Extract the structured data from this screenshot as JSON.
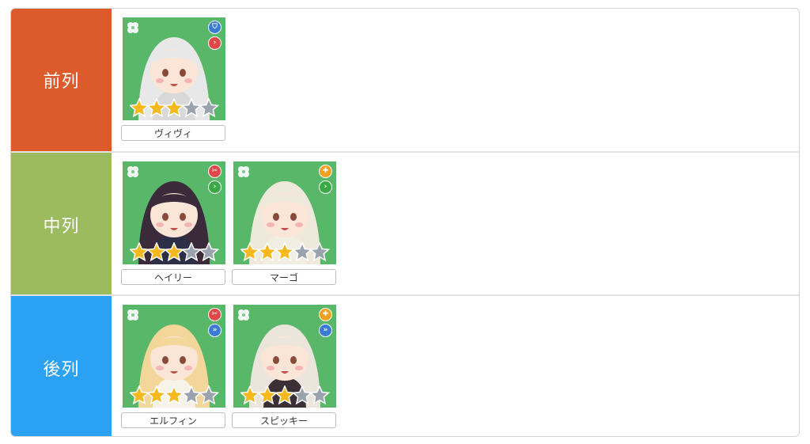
{
  "colors": {
    "front": "#dd5a2a",
    "middle": "#9bbb5e",
    "back": "#2aa1f2",
    "portrait_bg": "#59b76a",
    "star_gold": "#f6b81c",
    "star_gray": "#9aa3ad"
  },
  "rows": [
    {
      "label": "前列",
      "color": "#dd5a2a",
      "characters": [
        {
          "name": "ヴィヴィ",
          "stars": 3,
          "max_stars": 5,
          "badges": [
            {
              "icon": "shield-icon",
              "color": "#3a7bd5"
            },
            {
              "icon": "chevron-right-icon",
              "color": "#e04848"
            }
          ],
          "hair": "#e8e8e8",
          "outfit": "#d9d9d9"
        }
      ]
    },
    {
      "label": "中列",
      "color": "#9bbb5e",
      "characters": [
        {
          "name": "ヘイリー",
          "stars": 3,
          "max_stars": 5,
          "badges": [
            {
              "icon": "wrench-icon",
              "color": "#e04848"
            },
            {
              "icon": "chevron-right-icon",
              "color": "#3aa845"
            }
          ],
          "hair": "#3a2a3a",
          "outfit": "#2c2f45"
        },
        {
          "name": "マーゴ",
          "stars": 3,
          "max_stars": 5,
          "badges": [
            {
              "icon": "cross-icon",
              "color": "#f0a020"
            },
            {
              "icon": "chevron-right-icon",
              "color": "#3aa845"
            }
          ],
          "hair": "#efe9dc",
          "outfit": "#f2eee4"
        }
      ]
    },
    {
      "label": "後列",
      "color": "#2aa1f2",
      "characters": [
        {
          "name": "エルフィン",
          "stars": 3,
          "max_stars": 5,
          "badges": [
            {
              "icon": "wrench-icon",
              "color": "#e04848"
            },
            {
              "icon": "double-chevron-icon",
              "color": "#3a7bd5"
            }
          ],
          "hair": "#f3d79a",
          "outfit": "#f7f3e8"
        },
        {
          "name": "スピッキー",
          "stars": 3,
          "max_stars": 5,
          "badges": [
            {
              "icon": "cross-icon",
              "color": "#f0a020"
            },
            {
              "icon": "double-chevron-icon",
              "color": "#3a7bd5"
            }
          ],
          "hair": "#ece5dc",
          "outfit": "#3a3036"
        }
      ]
    }
  ]
}
